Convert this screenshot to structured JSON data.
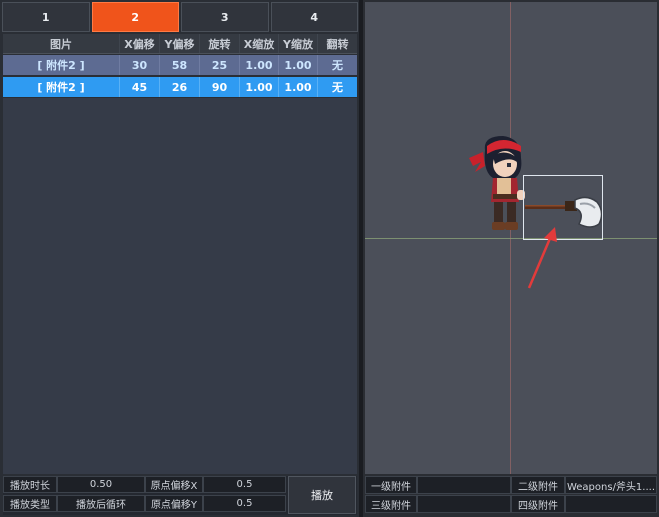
{
  "tabs": [
    {
      "label": "1"
    },
    {
      "label": "2",
      "active": true
    },
    {
      "label": "3"
    },
    {
      "label": "4"
    }
  ],
  "table": {
    "headers": [
      "图片",
      "X偏移",
      "Y偏移",
      "旋转",
      "X缩放",
      "Y缩放",
      "翻转"
    ],
    "rows": [
      {
        "image": "[ 附件2 ]",
        "x_offset": "30",
        "y_offset": "58",
        "rotation": "25",
        "x_scale": "1.00",
        "y_scale": "1.00",
        "flip": "无"
      },
      {
        "image": "[ 附件2 ]",
        "x_offset": "45",
        "y_offset": "26",
        "rotation": "90",
        "x_scale": "1.00",
        "y_scale": "1.00",
        "flip": "无",
        "selected": true
      }
    ]
  },
  "bottom_left": {
    "duration_label": "播放时长",
    "duration_value": "0.50",
    "origin_x_label": "原点偏移X",
    "origin_x_value": "0.5",
    "play_type_label": "播放类型",
    "play_type_value": "播放后循环",
    "origin_y_label": "原点偏移Y",
    "origin_y_value": "0.5",
    "play_button": "播放"
  },
  "bottom_right": {
    "level1_label": "一级附件",
    "level1_value": "",
    "level2_label": "二级附件",
    "level2_value": "Weapons/斧头1....",
    "level3_label": "三级附件",
    "level3_value": "",
    "level4_label": "四级附件",
    "level4_value": ""
  },
  "colors": {
    "accent_tab": "#f0541b",
    "selected_row": "#2f9bf2",
    "dim_row": "#5d6b92",
    "arrow": "#e23b3b"
  }
}
